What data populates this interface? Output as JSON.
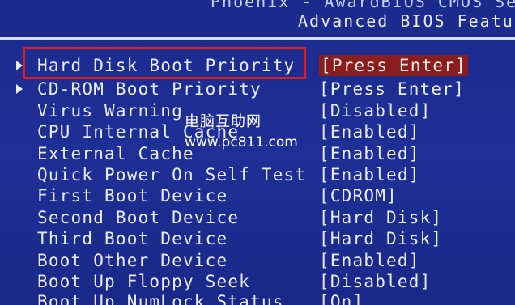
{
  "header": {
    "line1": "Phoenix - AwardBIOS CMOS Se",
    "line2": "Advanced BIOS Featu"
  },
  "menu": [
    {
      "label": "Hard Disk Boot Priority",
      "value": "[Press Enter]",
      "submenu": true,
      "selected": true
    },
    {
      "label": "CD-ROM Boot Priority",
      "value": "[Press Enter]",
      "submenu": true
    },
    {
      "label": "Virus Warning",
      "value": "[Disabled]"
    },
    {
      "label": "CPU Internal Cache",
      "value": "[Enabled]"
    },
    {
      "label": "External Cache",
      "value": "[Enabled]"
    },
    {
      "label": "Quick Power On Self Test",
      "value": "[Enabled]"
    },
    {
      "label": "First Boot Device",
      "value": "[CDROM]"
    },
    {
      "label": "Second Boot Device",
      "value": "[Hard Disk]"
    },
    {
      "label": "Third Boot Device",
      "value": "[Hard Disk]"
    },
    {
      "label": "Boot Other Device",
      "value": "[Enabled]"
    },
    {
      "label": "Boot Up Floppy Seek",
      "value": "[Disabled]"
    },
    {
      "label": "Boot Up NumLock Status",
      "value": "[On]"
    }
  ],
  "watermark": {
    "cn": "电脑互助网",
    "url": "www.pc811.com"
  },
  "colors": {
    "background": "#1c2b8f",
    "highlight": "#8a1e1e",
    "annotation_box": "#e21b1b"
  }
}
